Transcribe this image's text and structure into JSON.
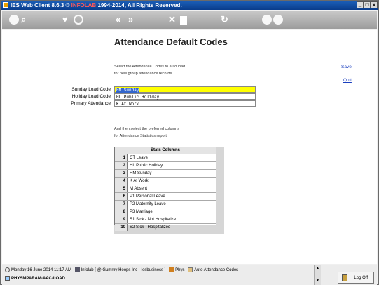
{
  "window": {
    "title_prefix": "IES Web Client 8.6.3 © ",
    "title_brand": "INFOLAB",
    "title_suffix": " 1994-2014, All Rights Reserved.",
    "minimize": "_",
    "restore": "□",
    "close": "x"
  },
  "toolbar": {
    "icons": [
      "info-icon",
      "search-icon",
      "heart-icon",
      "history-icon",
      "back-icon",
      "forward-icon",
      "tools-icon",
      "page-icon",
      "refresh-icon",
      "ok-icon",
      "cancel-icon"
    ],
    "back_glyph": "«",
    "forward_glyph": "»"
  },
  "page": {
    "title": "Attendance Default Codes",
    "intro_line1": "Select the Attendance Codes to auto load",
    "intro_line2": "for new group attendance records.",
    "save_label": "Save",
    "quit_label": "Quit",
    "sunday_label": "Sunday Load Code",
    "sunday_value": "HM Sunday",
    "holiday_label": "Holiday Load Code",
    "holiday_value": "HL Public Holiday",
    "primary_label": "Primary Attendance",
    "primary_value": "K At Work",
    "columns_line1": "And then select the preferred columns",
    "columns_line2": "for Attendance Statistics report."
  },
  "stats": {
    "header": "Stats Columns",
    "rows": [
      {
        "num": "1",
        "value": "CT Leave"
      },
      {
        "num": "2",
        "value": "HL Public Holiday"
      },
      {
        "num": "3",
        "value": "HM Sunday"
      },
      {
        "num": "4",
        "value": "K At Work"
      },
      {
        "num": "5",
        "value": "M Absent"
      },
      {
        "num": "6",
        "value": "P1 Personal Leave"
      },
      {
        "num": "7",
        "value": "P2 Maternity Leave"
      },
      {
        "num": "8",
        "value": "P3 Marriage"
      },
      {
        "num": "9",
        "value": "S1 Sick - Not Hospitalize"
      },
      {
        "num": "10",
        "value": "S2 Sick - Hospitalized"
      }
    ]
  },
  "status": {
    "date": "Monday 16 June 2014 11:17 AM",
    "company": "Infolab [ @ Gummy Hoops Inc - Iesbusiness ]",
    "module": "Phys",
    "screen": "Auto Attendance Codes",
    "code": "PHYSMPARAM-AAC-LOAD",
    "logoff": "Log Off"
  },
  "colors": {
    "title_bar": "#0a3d8c",
    "brand_red": "#ff5a5a",
    "active_field": "#ffff00",
    "link": "#1a3fbf"
  }
}
